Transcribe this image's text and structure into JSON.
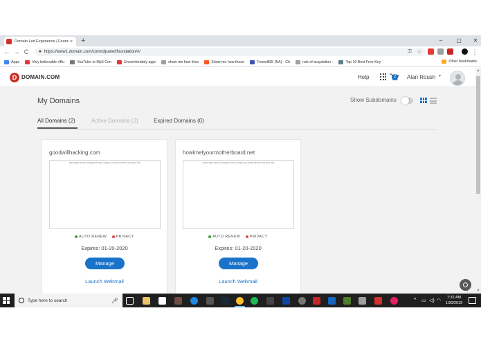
{
  "browser": {
    "tab_title": "Domain Led Experience | Foundation",
    "tab_close": "×",
    "new_tab": "+",
    "window_controls": [
      "–",
      "▢",
      "✕"
    ],
    "url": "https://www1.domain.com/controlpanel/foundation/#/",
    "back": "←",
    "forward": "→",
    "reload": "C",
    "key_icon": "⚿",
    "star_icon": "☆",
    "menu_icon": "⋮",
    "bookmarks": [
      {
        "label": "Apps",
        "color": "#4285f4"
      },
      {
        "label": "Very believable r/Bu",
        "color": "#e53935"
      },
      {
        "label": "YouTube to Mp3 Con",
        "color": "#777777"
      },
      {
        "label": "Uncomfortably appr",
        "color": "#e53935"
      },
      {
        "label": "show me how thoo",
        "color": "#9e9e9e"
      },
      {
        "label": "Show me how those",
        "color": "#ff5722"
      },
      {
        "label": "Freewill95 (NA) - Ch",
        "color": "#3f51b5"
      },
      {
        "label": "rule of acquisition -",
        "color": "#9e9e9e"
      },
      {
        "label": "Top 10 Best Free Key",
        "color": "#607d8b"
      }
    ],
    "other_bookmarks": "Other bookmarks"
  },
  "header": {
    "logo_letter": "D",
    "logo_text": "DOMAIN.COM",
    "help": "Help",
    "cart_count": "2",
    "user_name": "Alan Roush",
    "caret": "▾"
  },
  "main": {
    "title": "My Domains",
    "show_subdomains": "Show Subdomains",
    "tabs": [
      {
        "label": "All Domains (2)"
      },
      {
        "label": "Active Domains (2)"
      },
      {
        "label": "Expired Domains (0)"
      }
    ],
    "cards": [
      {
        "domain": "goodwillhacking.com",
        "preview_text": "Domain Page: Domain not Registered. Please configure your domain with this control panel. Click",
        "auto_renew": "AUTO RENEW",
        "privacy": "PRIVACY",
        "expires": "Expires: 01-20-2020",
        "manage": "Manage",
        "webmail": "Launch Webmail"
      },
      {
        "domain": "howimetyourmotherboard.net",
        "preview_text": "Domain Page: Domain not Registered. Please configure your domain with this control panel. Click",
        "auto_renew": "AUTO RENEW",
        "privacy": "PRIVACY",
        "expires": "Expires: 01-20-2020",
        "manage": "Manage",
        "webmail": "Launch Webmail"
      }
    ]
  },
  "taskbar": {
    "search_placeholder": "Type here to search",
    "time": "7:32 AM",
    "date": "1/20/2019",
    "tray_caret": "^",
    "tray_symbols": [
      "▭",
      "◁)",
      "◠"
    ],
    "mic": "🎤︎"
  },
  "colors": {
    "brand_red": "#c9302c",
    "accent_blue": "#1a73c9",
    "auto_renew_green": "#3fa535",
    "privacy_red": "#d9534f"
  }
}
